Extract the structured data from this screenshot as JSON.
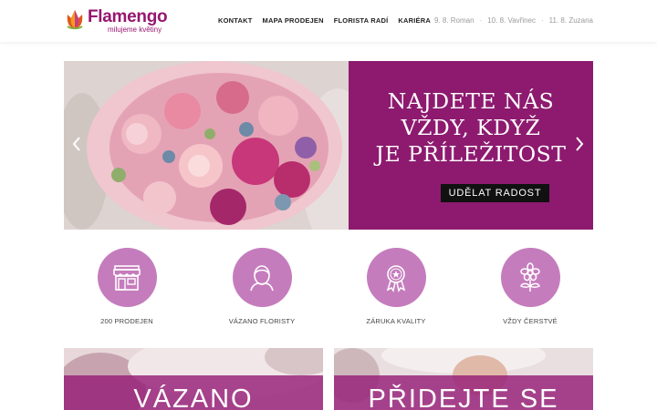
{
  "brand": {
    "name": "Flamengo",
    "tagline": "milujeme květiny",
    "color": "#96176f"
  },
  "nav": {
    "items": [
      "KONTAKT",
      "MAPA PRODEJEN",
      "FLORISTA RADÍ",
      "KARIÉRA"
    ]
  },
  "namedays": [
    "9. 8. Roman",
    "10. 8. Vavřinec",
    "11. 8. Zuzana"
  ],
  "hero": {
    "title_lines": [
      "NAJDETE NÁS",
      "VŽDY, KDYŽ",
      "JE PŘÍLEŽITOST"
    ],
    "button_label": "UDĚLAT RADOST",
    "panel_color": "#8d1a6f"
  },
  "features": [
    {
      "label": "200 PRODEJEN",
      "icon": "storefront-icon"
    },
    {
      "label": "VÁZANO FLORISTY",
      "icon": "florist-icon"
    },
    {
      "label": "ZÁRUKA KVALITY",
      "icon": "quality-badge-icon"
    },
    {
      "label": "VŽDY ČERSTVÉ",
      "icon": "flower-icon"
    }
  ],
  "cards": [
    {
      "title": "VÁZANO"
    },
    {
      "title": "PŘIDEJTE SE"
    }
  ]
}
